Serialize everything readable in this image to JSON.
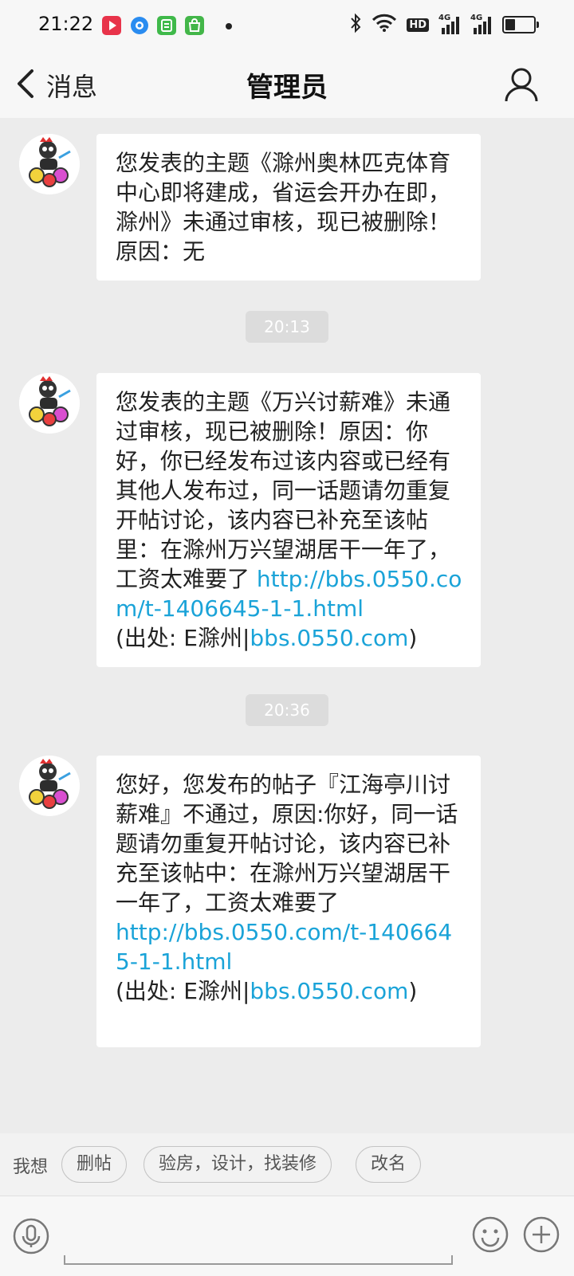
{
  "status_bar": {
    "time": "21:22",
    "app_icons": [
      {
        "name": "video-app-icon",
        "color": "#e8334a"
      },
      {
        "name": "browser-app-icon",
        "color": "#2a8cf0"
      },
      {
        "name": "reader-app-icon",
        "color": "#3fb94a"
      },
      {
        "name": "shop-app-icon",
        "color": "#43b649"
      }
    ],
    "hd_label": "HD",
    "network_labels": [
      "4G",
      "4G"
    ]
  },
  "header": {
    "back_label": "消息",
    "title": "管理员"
  },
  "messages": [
    {
      "type": "text",
      "parts": [
        {
          "text": "您发表的主题《滁州奥林匹克体育中心即将建成，省运会开办在即，滁州》未通过审核，现已被删除！原因：无",
          "link": false
        }
      ]
    },
    {
      "type": "timestamp",
      "text": "20:13"
    },
    {
      "type": "text",
      "parts": [
        {
          "text": "您发表的主题《万兴讨薪难》未通过审核，现已被删除！原因：你好，你已经发布过该内容或已经有其他人发布过，同一话题请勿重复开帖讨论，该内容已补充至该帖里：在滁州万兴望湖居干一年了，工资太难要了 ",
          "link": false
        },
        {
          "text": "http://bbs.0550.com/t-1406645-1-1.html",
          "link": true
        },
        {
          "text": "(出处: E滁州|",
          "link": false,
          "newline": true
        },
        {
          "text": "bbs.0550.com",
          "link": true
        },
        {
          "text": ")",
          "link": false
        }
      ]
    },
    {
      "type": "timestamp",
      "text": "20:36"
    },
    {
      "type": "text",
      "parts": [
        {
          "text": "您好，您发布的帖子『江海亭川讨薪难』不通过，原因:你好，同一话题请勿重复开帖讨论，该内容已补充至该帖中：在滁州万兴望湖居干一年了，工资太难要了",
          "link": false
        },
        {
          "text": "http://bbs.0550.com/t-1406645-1-1.html",
          "link": true,
          "newline": true
        },
        {
          "text": "(出处: E滁州|",
          "link": false,
          "newline": true
        },
        {
          "text": "bbs.0550.com",
          "link": true
        },
        {
          "text": ")",
          "link": false
        }
      ]
    }
  ],
  "quick_replies": {
    "label": "我想",
    "chips": [
      "删帖",
      "验房，设计，找装修",
      "改名"
    ]
  },
  "input_bar": {
    "left_icon": "voice-icon",
    "right_icons": [
      "emoji-icon",
      "plus-icon"
    ]
  }
}
